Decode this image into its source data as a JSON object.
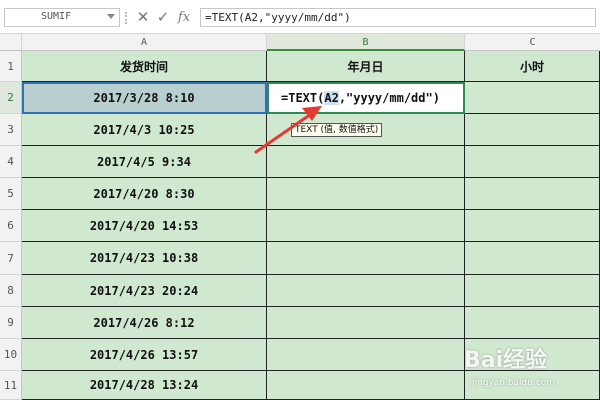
{
  "formula_bar": {
    "name_box": "SUMIF",
    "cancel_icon": "✕",
    "accept_icon": "✓",
    "fx_label": "fx",
    "formula": "=TEXT(A2,\"yyyy/mm/dd\")"
  },
  "columns": {
    "a": "A",
    "b": "B",
    "c": "C"
  },
  "rows": [
    "1",
    "2",
    "3",
    "4",
    "5",
    "6",
    "7",
    "8",
    "9",
    "10",
    "11"
  ],
  "headers": {
    "a": "发货时间",
    "b": "年月日",
    "c": "小时"
  },
  "column_a": [
    "2017/3/28 8:10",
    "2017/4/3 10:25",
    "2017/4/5 9:34",
    "2017/4/20 8:30",
    "2017/4/20 14:53",
    "2017/4/23 10:38",
    "2017/4/23 20:24",
    "2017/4/26 8:12",
    "2017/4/26 13:57",
    "2017/4/28 13:24"
  ],
  "editing": {
    "prefix": "=TEXT(",
    "ref": "A2",
    "suffix": ",\"yyyy/mm/dd\")"
  },
  "tooltip": "TEXT (值, 数值格式)",
  "watermark": {
    "logo": "Bai经验",
    "url": "jingyan.baidu.com"
  },
  "colors": {
    "cell_fill": "#cfe8cf",
    "selected_ref": "#2f6fb3",
    "active_cell": "#2e8b57",
    "arrow": "#e53935"
  }
}
